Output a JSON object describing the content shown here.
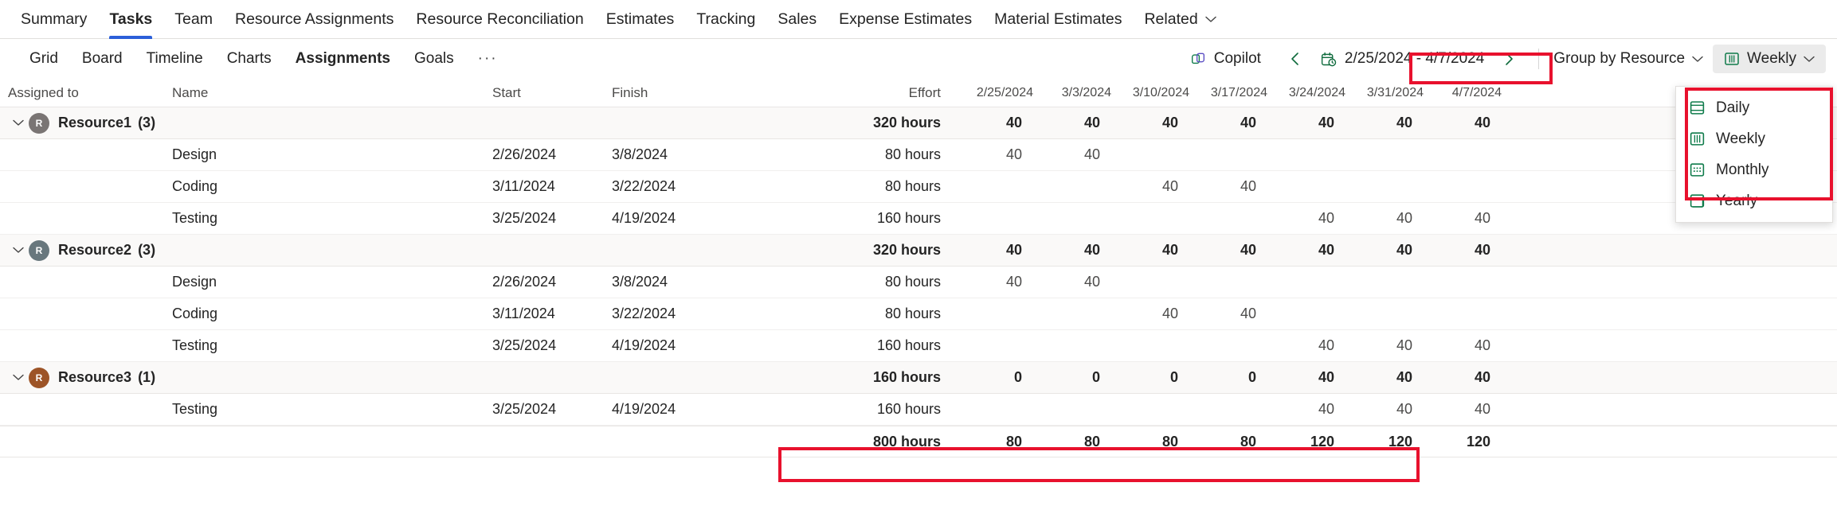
{
  "top_nav": {
    "items": [
      {
        "label": "Summary",
        "active": false
      },
      {
        "label": "Tasks",
        "active": true
      },
      {
        "label": "Team",
        "active": false
      },
      {
        "label": "Resource Assignments",
        "active": false
      },
      {
        "label": "Resource Reconciliation",
        "active": false
      },
      {
        "label": "Estimates",
        "active": false
      },
      {
        "label": "Tracking",
        "active": false
      },
      {
        "label": "Sales",
        "active": false
      },
      {
        "label": "Expense Estimates",
        "active": false
      },
      {
        "label": "Material Estimates",
        "active": false
      },
      {
        "label": "Related",
        "active": false,
        "caret": true
      }
    ]
  },
  "sub_tabs": {
    "items": [
      {
        "label": "Grid",
        "active": false
      },
      {
        "label": "Board",
        "active": false
      },
      {
        "label": "Timeline",
        "active": false
      },
      {
        "label": "Charts",
        "active": false
      },
      {
        "label": "Assignments",
        "active": true
      },
      {
        "label": "Goals",
        "active": false
      }
    ],
    "overflow_label": "···"
  },
  "toolbar": {
    "copilot_label": "Copilot",
    "prev_label": "‹",
    "next_label": "›",
    "date_range": "2/25/2024 - 4/7/2024",
    "group_by_label": "Group by Resource",
    "scale_label": "Weekly",
    "caret": "∨"
  },
  "scale_menu": {
    "items": [
      {
        "label": "Daily",
        "icon": "day-view-icon"
      },
      {
        "label": "Weekly",
        "icon": "week-view-icon"
      },
      {
        "label": "Monthly",
        "icon": "month-view-icon"
      },
      {
        "label": "Yearly",
        "icon": "year-view-icon"
      }
    ]
  },
  "table": {
    "headers": {
      "assigned_to": "Assigned to",
      "name": "Name",
      "start": "Start",
      "finish": "Finish",
      "effort": "Effort",
      "periods": [
        "2/25/2024",
        "3/3/2024",
        "3/10/2024",
        "3/17/2024",
        "3/24/2024",
        "3/31/2024",
        "4/7/2024"
      ]
    },
    "groups": [
      {
        "name": "Resource1",
        "count": "(3)",
        "initial": "R",
        "avatar_color": "#7a7574",
        "effort": "320 hours",
        "periods": [
          "40",
          "40",
          "40",
          "40",
          "40",
          "40",
          "40"
        ],
        "tasks": [
          {
            "name": "Design",
            "start": "2/26/2024",
            "finish": "3/8/2024",
            "effort": "80 hours",
            "periods": [
              "40",
              "40",
              "",
              "",
              "",
              "",
              ""
            ]
          },
          {
            "name": "Coding",
            "start": "3/11/2024",
            "finish": "3/22/2024",
            "effort": "80 hours",
            "periods": [
              "",
              "",
              "40",
              "40",
              "",
              "",
              ""
            ]
          },
          {
            "name": "Testing",
            "start": "3/25/2024",
            "finish": "4/19/2024",
            "effort": "160 hours",
            "periods": [
              "",
              "",
              "",
              "",
              "40",
              "40",
              "40"
            ]
          }
        ]
      },
      {
        "name": "Resource2",
        "count": "(3)",
        "initial": "R",
        "avatar_color": "#68777d",
        "effort": "320 hours",
        "periods": [
          "40",
          "40",
          "40",
          "40",
          "40",
          "40",
          "40"
        ],
        "tasks": [
          {
            "name": "Design",
            "start": "2/26/2024",
            "finish": "3/8/2024",
            "effort": "80 hours",
            "periods": [
              "40",
              "40",
              "",
              "",
              "",
              "",
              ""
            ]
          },
          {
            "name": "Coding",
            "start": "3/11/2024",
            "finish": "3/22/2024",
            "effort": "80 hours",
            "periods": [
              "",
              "",
              "40",
              "40",
              "",
              "",
              ""
            ]
          },
          {
            "name": "Testing",
            "start": "3/25/2024",
            "finish": "4/19/2024",
            "effort": "160 hours",
            "periods": [
              "",
              "",
              "",
              "",
              "40",
              "40",
              "40"
            ]
          }
        ]
      },
      {
        "name": "Resource3",
        "count": "(1)",
        "initial": "R",
        "avatar_color": "#9d5427",
        "effort": "160 hours",
        "periods": [
          "0",
          "0",
          "0",
          "0",
          "40",
          "40",
          "40"
        ],
        "tasks": [
          {
            "name": "Testing",
            "start": "3/25/2024",
            "finish": "4/19/2024",
            "effort": "160 hours",
            "periods": [
              "",
              "",
              "",
              "",
              "40",
              "40",
              "40"
            ]
          }
        ]
      }
    ],
    "total": {
      "effort": "800 hours",
      "periods": [
        "80",
        "80",
        "80",
        "80",
        "120",
        "120",
        "120"
      ]
    }
  },
  "annotations": {
    "highlight_color": "#e8112d"
  }
}
